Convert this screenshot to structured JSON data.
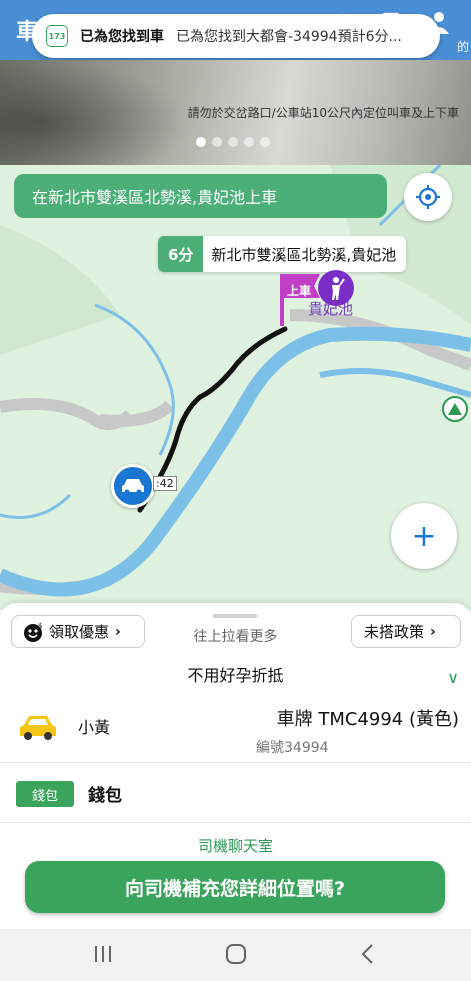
{
  "app": {
    "title_char": "車",
    "topbar_label_right": "的"
  },
  "notification": {
    "logo_text": "173",
    "title": "已為您找到車",
    "text": "已為您找到大都會-34994預計6分..."
  },
  "banner": {
    "text": "請勿於交岔路口/公車站10公尺內定位叫車及上下車",
    "dots_total": 5,
    "active_dot": 1
  },
  "map": {
    "pickup_text": "在新北市雙溪區北勢溪,貴妃池上車",
    "eta_minutes": "6分",
    "eta_place": "新北市雙溪區北勢溪,貴妃池",
    "flag_label": "上車",
    "place_label": "貴妃池",
    "road_number": ":42",
    "zoom_label": "+"
  },
  "sheet": {
    "promo_label": "領取優惠",
    "pull_hint": "往上拉看更多",
    "policy_label": "未搭政策",
    "preference": "不用好孕折抵",
    "vehicle_type": "小黃",
    "plate": "車牌 TMC4994 (黃色)",
    "vehicle_number": "編號34994",
    "wallet_badge": "錢包",
    "wallet_label": "錢包",
    "chat_link": "司機聊天室",
    "cta": "向司機補充您詳細位置嗎?"
  },
  "colors": {
    "brand_green": "#3aa35c",
    "topbar_blue": "#4a8fd6",
    "map_bg": "#dff1df",
    "river": "#7cc0e8",
    "route": "#111111",
    "marker_purple": "#7b2ec7",
    "car_blue": "#1976d2"
  }
}
